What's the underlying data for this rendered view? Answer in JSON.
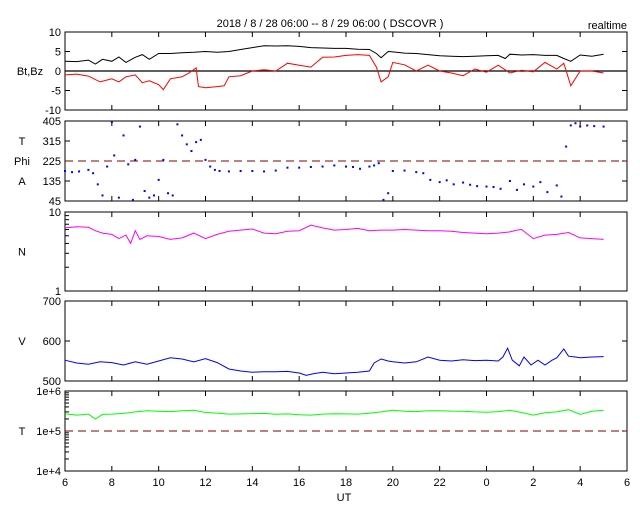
{
  "chart_data": {
    "type": "line",
    "title": "2018 / 8 / 28  06:00 -- 8 / 29  06:00 ( DSCOVR )",
    "annotation": "realtime",
    "xlabel": "UT",
    "xlim": [
      6,
      30
    ],
    "x_ticks": [
      6,
      8,
      10,
      12,
      14,
      16,
      18,
      20,
      22,
      24,
      26,
      28,
      30
    ],
    "x_tick_labels": [
      "6",
      "8",
      "10",
      "12",
      "14",
      "16",
      "18",
      "20",
      "22",
      "0",
      "2",
      "4",
      "6"
    ],
    "colors": {
      "bt": "#000000",
      "bz": "#ff0000",
      "phi": "#0000ff",
      "n": "#ff00ff",
      "v": "#0000ff",
      "t": "#00ff00",
      "ref": "#800000"
    },
    "panels": [
      {
        "id": "mag",
        "ylabel": [
          "Bt,Bz"
        ],
        "scale": "linear",
        "ylim": [
          -10,
          10
        ],
        "tick_labels": [
          "10",
          "5",
          "0",
          "-5",
          "-10"
        ],
        "ticks": [
          10,
          5,
          0,
          -5,
          -10
        ],
        "ref_line": {
          "value": 0,
          "style": "solid"
        },
        "series": [
          {
            "name": "Bt",
            "color_key": "bt",
            "x": [
              6,
              6.5,
              7,
              7.3,
              7.6,
              8,
              8.3,
              8.6,
              9,
              9.3,
              9.6,
              10,
              10.5,
              11,
              11.5,
              12,
              12.5,
              13,
              13.5,
              14,
              14.5,
              15,
              15.5,
              16,
              16.5,
              17,
              17.5,
              18,
              18.5,
              19,
              19.3,
              19.5,
              19.8,
              20,
              20.5,
              21,
              21.5,
              22,
              22.5,
              23,
              23.5,
              24,
              24.5,
              24.8,
              25,
              25.5,
              26,
              26.5,
              27,
              27.3,
              27.6,
              28,
              28.5,
              29
            ],
            "y": [
              2.5,
              2.4,
              2.8,
              1.8,
              3,
              2.5,
              3.6,
              2.2,
              3.5,
              4.2,
              3,
              4.5,
              4.5,
              4.7,
              4.8,
              5,
              4.8,
              5,
              5.5,
              6,
              6.5,
              6.4,
              6.5,
              6.3,
              6,
              5.9,
              5.8,
              5.8,
              5.6,
              5.5,
              4.5,
              3.4,
              5,
              4.9,
              4.6,
              4.5,
              4.2,
              3.9,
              3.8,
              3.7,
              3.8,
              3.9,
              4,
              3.2,
              4.3,
              4.1,
              4.2,
              4,
              4,
              3.2,
              2.5,
              4.1,
              3.8,
              4.3
            ]
          },
          {
            "name": "Bz",
            "color_key": "bz",
            "x": [
              6,
              6.5,
              7,
              7.5,
              8,
              8.3,
              8.6,
              9,
              9.3,
              9.6,
              10,
              10.2,
              10.5,
              11,
              11.3,
              11.6,
              11.7,
              12,
              12.5,
              12.8,
              13,
              13.5,
              14,
              14.5,
              15,
              15.5,
              16,
              16.5,
              17,
              17.5,
              18,
              18.5,
              19,
              19.3,
              19.5,
              19.8,
              20,
              20.5,
              21,
              21.5,
              22,
              22.5,
              23,
              23.5,
              24,
              24.5,
              25,
              25.5,
              26,
              26.5,
              27,
              27.3,
              27.6,
              28,
              28.5,
              29
            ],
            "y": [
              -1,
              -0.8,
              -1.3,
              -2.8,
              -2,
              -2.8,
              -1.5,
              -1,
              -3,
              -2.5,
              -3.5,
              -4.8,
              -2,
              -1.5,
              -0.5,
              0.8,
              -4,
              -4.3,
              -4,
              -3.8,
              -1.5,
              -1.2,
              0,
              0.3,
              0,
              2,
              1.5,
              1,
              3.5,
              3.6,
              4,
              4.2,
              4,
              1,
              -2.8,
              -1.5,
              2.2,
              1.6,
              0,
              1.5,
              0,
              -0.5,
              -1.2,
              0.5,
              -0.3,
              1.5,
              -0.5,
              0.2,
              -0.2,
              2.2,
              0.5,
              2,
              -3.8,
              0,
              0,
              -0.5
            ]
          }
        ]
      },
      {
        "id": "phi",
        "ylabel": [
          "T",
          "Phi",
          "A"
        ],
        "scale": "linear",
        "ylim": [
          45,
          405
        ],
        "tick_labels": [
          "405",
          "315",
          "225",
          "135",
          "45"
        ],
        "ticks": [
          405,
          315,
          225,
          135,
          45
        ],
        "ref_line": {
          "value": 225,
          "style": "dashed"
        },
        "series": [
          {
            "name": "Phi",
            "color_key": "phi",
            "render": "dots",
            "x": [
              6,
              6.3,
              6.6,
              7,
              7.2,
              7.4,
              7.6,
              7.8,
              8,
              8.1,
              8.3,
              8.5,
              8.7,
              8.9,
              9,
              9.2,
              9.4,
              9.6,
              9.8,
              10,
              10.2,
              10.4,
              10.6,
              10.8,
              11,
              11.2,
              11.4,
              11.6,
              11.8,
              12,
              12.2,
              12.4,
              12.6,
              13,
              13.5,
              14,
              14.5,
              15,
              15.5,
              16,
              16.5,
              17,
              17.5,
              18,
              18.3,
              18.6,
              19,
              19.2,
              19.4,
              19.6,
              19.8,
              20,
              20.5,
              21,
              21.3,
              21.6,
              22,
              22.3,
              22.6,
              23,
              23.3,
              23.6,
              24,
              24.3,
              24.6,
              25,
              25.3,
              25.6,
              26,
              26.3,
              26.6,
              27,
              27.2,
              27.4,
              27.6,
              27.8,
              28,
              28.3,
              28.6,
              29
            ],
            "y": [
              180,
              175,
              178,
              185,
              170,
              120,
              70,
              200,
              400,
              250,
              60,
              340,
              210,
              50,
              230,
              380,
              90,
              60,
              70,
              140,
              230,
              80,
              70,
              390,
              340,
              300,
              270,
              310,
              320,
              230,
              200,
              185,
              180,
              178,
              180,
              180,
              178,
              182,
              195,
              195,
              198,
              200,
              205,
              200,
              198,
              190,
              200,
              205,
              215,
              50,
              80,
              180,
              182,
              175,
              170,
              140,
              130,
              138,
              120,
              128,
              118,
              112,
              110,
              108,
              100,
              135,
              95,
              120,
              110,
              130,
              85,
              115,
              65,
              290,
              385,
              395,
              380,
              385,
              382,
              380
            ]
          }
        ]
      },
      {
        "id": "density",
        "ylabel": [
          "N"
        ],
        "scale": "log",
        "ylim": [
          1,
          10
        ],
        "tick_labels": [
          "10",
          "1"
        ],
        "ticks": [
          10,
          1
        ],
        "series": [
          {
            "name": "N",
            "color_key": "n",
            "x": [
              6,
              6.5,
              7,
              7.3,
              7.6,
              8,
              8.3,
              8.6,
              8.8,
              9,
              9.2,
              9.5,
              10,
              10.5,
              11,
              11.5,
              12,
              12.5,
              13,
              13.5,
              14,
              14.5,
              15,
              15.5,
              16,
              16.5,
              17,
              17.5,
              18,
              18.5,
              19,
              19.5,
              20,
              20.5,
              21,
              21.5,
              22,
              22.5,
              23,
              23.5,
              24,
              24.5,
              25,
              25.3,
              25.5,
              26,
              26.5,
              27,
              27.5,
              28,
              28.5,
              29
            ],
            "y": [
              6.3,
              6.5,
              6.4,
              5.8,
              5.4,
              5.2,
              4.6,
              5.1,
              4,
              5.8,
              4.5,
              5,
              4.9,
              4.5,
              4.7,
              5.4,
              4.6,
              5.2,
              5.7,
              5.9,
              6.1,
              5.4,
              5.3,
              5.7,
              5.8,
              6.8,
              6.3,
              5.9,
              6,
              6.2,
              5.8,
              5.9,
              5.9,
              6,
              5.9,
              5.8,
              5.8,
              5.7,
              5.5,
              5.4,
              5.3,
              5.4,
              5.6,
              5.9,
              6,
              4.6,
              5.1,
              5.2,
              5.5,
              4.7,
              4.6,
              4.5
            ]
          }
        ]
      },
      {
        "id": "speed",
        "ylabel": [
          "V"
        ],
        "scale": "linear",
        "ylim": [
          500,
          700
        ],
        "tick_labels": [
          "700",
          "600",
          "500"
        ],
        "ticks": [
          700,
          600,
          500
        ],
        "series": [
          {
            "name": "V",
            "color_key": "v",
            "x": [
              6,
              6.5,
              7,
              7.5,
              8,
              8.5,
              9,
              9.5,
              10,
              10.5,
              11,
              11.5,
              12,
              12.5,
              13,
              13.5,
              14,
              14.5,
              15,
              15.5,
              16,
              16.3,
              16.6,
              17,
              17.5,
              18,
              18.5,
              19,
              19.2,
              19.5,
              19.8,
              20,
              20.5,
              21,
              21.5,
              22,
              22.5,
              23,
              23.5,
              24,
              24.5,
              24.7,
              24.9,
              25.1,
              25.4,
              25.6,
              25.9,
              26.2,
              26.5,
              26.8,
              27,
              27.3,
              27.5,
              27.8,
              28,
              28.5,
              29
            ],
            "y": [
              552,
              545,
              542,
              548,
              546,
              540,
              548,
              542,
              550,
              558,
              555,
              548,
              556,
              546,
              530,
              525,
              522,
              523,
              523,
              524,
              520,
              514,
              518,
              522,
              518,
              520,
              522,
              525,
              545,
              555,
              550,
              548,
              545,
              548,
              560,
              552,
              550,
              553,
              551,
              552,
              550,
              560,
              582,
              552,
              538,
              560,
              540,
              552,
              540,
              552,
              558,
              580,
              562,
              560,
              558,
              560,
              561
            ]
          }
        ]
      },
      {
        "id": "temperature",
        "ylabel": [
          "T"
        ],
        "scale": "log",
        "ylim": [
          10000,
          1000000
        ],
        "tick_labels": [
          "1e+6",
          "1e+5",
          "1e+4"
        ],
        "ticks": [
          1000000,
          100000,
          10000
        ],
        "ref_line": {
          "value": 100000,
          "style": "dashed"
        },
        "series": [
          {
            "name": "T",
            "color_key": "t",
            "x": [
              6,
              6.5,
              7,
              7.3,
              7.6,
              8,
              8.5,
              9,
              9.5,
              10,
              10.5,
              11,
              11.5,
              12,
              12.5,
              13,
              13.5,
              14,
              14.5,
              15,
              15.5,
              16,
              16.5,
              17,
              17.5,
              18,
              18.5,
              19,
              19.5,
              20,
              20.5,
              21,
              21.5,
              22,
              22.5,
              23,
              23.5,
              24,
              24.5,
              25,
              25.5,
              26,
              26.5,
              27,
              27.5,
              28,
              28.5,
              29
            ],
            "y": [
              270000,
              250000,
              265000,
              200000,
              260000,
              265000,
              275000,
              300000,
              320000,
              310000,
              305000,
              320000,
              330000,
              290000,
              280000,
              265000,
              268000,
              272000,
              275000,
              262000,
              268000,
              255000,
              250000,
              265000,
              270000,
              268000,
              265000,
              278000,
              300000,
              330000,
              310000,
              305000,
              320000,
              322000,
              315000,
              312000,
              300000,
              295000,
              305000,
              330000,
              290000,
              250000,
              285000,
              300000,
              340000,
              260000,
              310000,
              330000
            ]
          }
        ]
      }
    ]
  }
}
